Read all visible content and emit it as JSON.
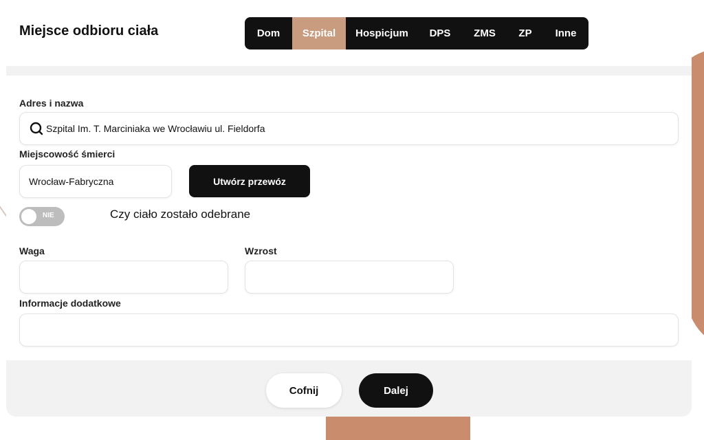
{
  "header": {
    "title": "Miejsce odbioru ciała",
    "tabs": [
      {
        "label": "Dom",
        "active": false
      },
      {
        "label": "Szpital",
        "active": true
      },
      {
        "label": "Hospicjum",
        "active": false
      },
      {
        "label": "DPS",
        "active": false
      },
      {
        "label": "ZMS",
        "active": false
      },
      {
        "label": "ZP",
        "active": false
      },
      {
        "label": "Inne",
        "active": false
      }
    ]
  },
  "form": {
    "address_label": "Adres i nazwa",
    "address_value": "Szpital Im. T. Marciniaka we Wrocławiu ul. Fieldorfa",
    "city_label": "Miejscowość śmierci",
    "city_value": "Wrocław-Fabryczna",
    "create_transport_label": "Utwórz przewóz",
    "toggle_state_label": "NIE",
    "toggle_caption": "Czy ciało zostało odebrane",
    "weight_label": "Waga",
    "weight_value": "",
    "height_label": "Wzrost",
    "height_value": "",
    "additional_info_label": "Informacje dodatkowe",
    "additional_info_value": ""
  },
  "footer": {
    "back_label": "Cofnij",
    "next_label": "Dalej"
  },
  "colors": {
    "accent": "#c99c80",
    "dark": "#111111",
    "toggle_off": "#bdbdbd"
  }
}
